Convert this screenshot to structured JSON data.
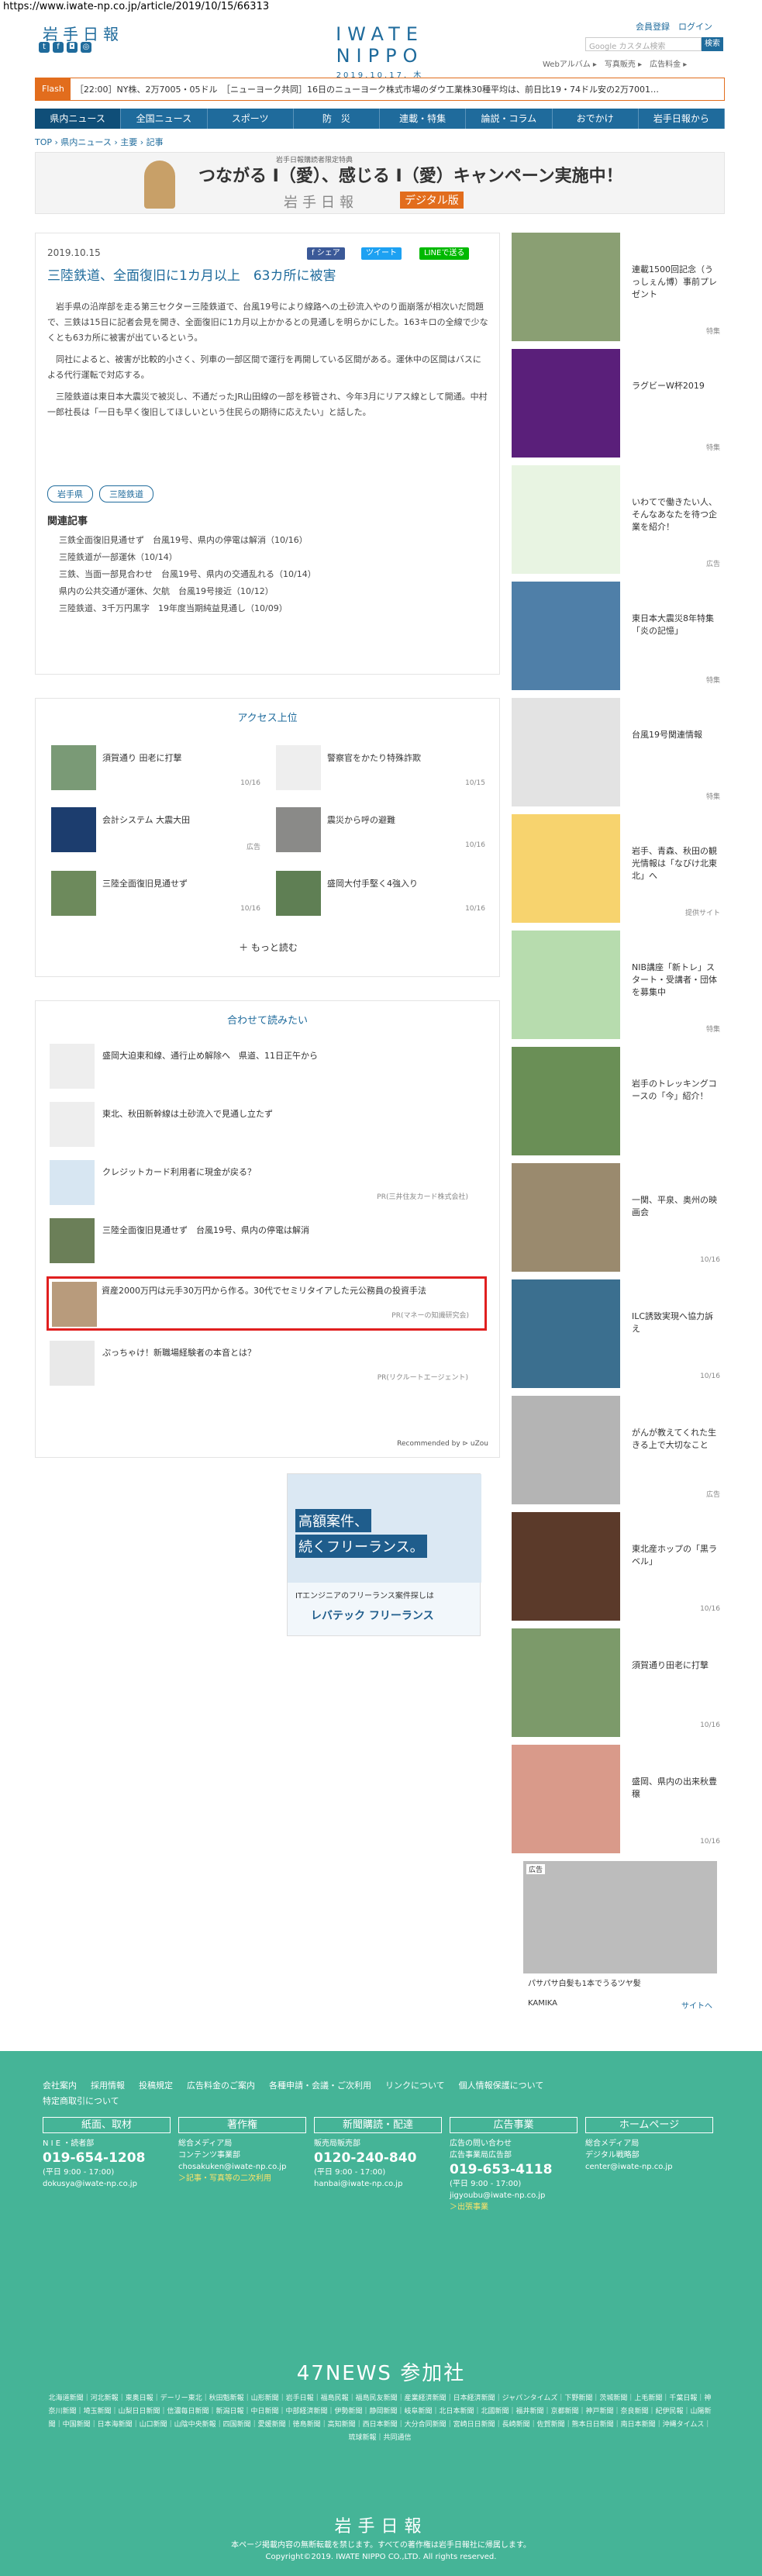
{
  "url": "https://www.iwate-np.co.jp/article/2019/10/15/66313",
  "header": {
    "logo_left": "岩手日報",
    "logo_center": "IWATE NIPPO",
    "date": "2019.10.17. 木",
    "member": "会員登録　ログイン",
    "search_placeholder": "Google カスタム検索",
    "search_btn": "検索",
    "sublinks": "Webアルバム ▸　写真販売 ▸　広告料金 ▸",
    "social": [
      "t",
      "f",
      "◘",
      "◎"
    ]
  },
  "ticker": {
    "label": "Flash",
    "text": "［22:00］NY株、2万7005・05ドル　［ニューヨーク共同］16日のニューヨーク株式市場のダウ工業株30種平均は、前日比19・74ドル安の2万7001…"
  },
  "nav": [
    "県内ニュース",
    "全国ニュース",
    "スポーツ",
    "防　災",
    "連載・特集",
    "論説・コラム",
    "おでかけ",
    "岩手日報から"
  ],
  "breadcrumb": "TOP › 県内ニュース › 主要 › 記事",
  "banner": {
    "title": "つながる I（愛）、感じる I（愛）キャンペーン実施中！",
    "sub": "岩手日報",
    "digital": "デジタル版",
    "top": "岩手日報購読者限定特典"
  },
  "article": {
    "date": "2019.10.15",
    "share": [
      "f シェア",
      "ツイート",
      "LINEで送る"
    ],
    "title": "三陸鉄道、全面復旧に1カ月以上　63カ所に被害",
    "paragraphs": [
      "岩手県の沿岸部を走る第三セクター三陸鉄道で、台風19号により線路への土砂流入やのり面崩落が相次いだ問題で、三鉄は15日に記者会見を開き、全面復旧に1カ月以上かかるとの見通しを明らかにした。163キロの全線で少なくとも63カ所に被害が出ているという。",
      "同社によると、被害が比較的小さく、列車の一部区間で運行を再開している区間がある。運休中の区間はバスによる代行運転で対応する。",
      "三陸鉄道は東日本大震災で被災し、不通だったJR山田線の一部を移管され、今年3月にリアス線として開通。中村一郎社長は「一日も早く復旧してほしいという住民らの期待に応えたい」と話した。"
    ],
    "tags": [
      "岩手県",
      "三陸鉄道"
    ],
    "related_heading": "関連記事",
    "related": [
      "三鉄全面復旧見通せず　台風19号、県内の停電は解消（10/16）",
      "三陸鉄道が一部運休（10/14）",
      "三鉄、当面一部見合わせ　台風19号、県内の交通乱れる（10/14）",
      "県内の公共交通が運休、欠航　台風19号接近（10/12）",
      "三陸鉄道、3千万円黒字　19年度当期純益見通し（10/09）"
    ]
  },
  "access": {
    "heading": "アクセス上位",
    "items": [
      {
        "title": "須賀通り 田老に打撃",
        "date": "10/16"
      },
      {
        "title": "警察官をかたり特殊詐欺",
        "date": "10/15"
      },
      {
        "title": "会計システム 大震大田",
        "date": "広告"
      },
      {
        "title": "震災から呼の避難",
        "date": "10/16"
      },
      {
        "title": "三陸全面復旧見通せず",
        "date": "10/16"
      },
      {
        "title": "盛岡大付手堅く4強入り",
        "date": "10/16"
      }
    ],
    "more": "＋ もっと読む"
  },
  "reads": {
    "heading": "合わせて読みたい",
    "items": [
      {
        "title": "盛岡大迫東和線、通行止め解除へ　県道、11日正午から",
        "pr": ""
      },
      {
        "title": "東北、秋田新幹線は土砂流入で見通し立たず",
        "pr": ""
      },
      {
        "title": "クレジットカード利用者に現金が戻る？",
        "pr": "PR(三井住友カード株式会社)"
      },
      {
        "title": "三陸全面復旧見通せず　台風19号、県内の停電は解消",
        "pr": ""
      },
      {
        "title": "資産2000万円は元手30万円から作る。30代でセミリタイアした元公務員の投資手法",
        "pr": "PR(マネーの知識研究会)"
      },
      {
        "title": "ぷっちゃけ！新職場経験者の本音とは？",
        "pr": "PR(リクルートエージェント)"
      }
    ],
    "recommended": "Recommended by ⊳ uZou"
  },
  "ad2": {
    "line1": "高額案件、",
    "line2": "続くフリーランス。",
    "line3": "ITエンジニアのフリーランス案件探しは",
    "brand": "レバテック フリーランス"
  },
  "sidebar": [
    {
      "title": "連載1500回記念（うっしぇん博）事前プレゼント",
      "tag": "特集"
    },
    {
      "title": "ラグビーW杯2019",
      "tag": "特集"
    },
    {
      "title": "いわてで働きたい人、そんなあなたを待つ企業を紹介！",
      "tag": "広告"
    },
    {
      "title": "東日本大震災8年特集「炎の記憶」",
      "tag": "特集"
    },
    {
      "title": "台風19号関連情報",
      "tag": "特集"
    },
    {
      "title": "岩手、青森、秋田の観光情報は「なびけ北東北」へ",
      "tag": "提供サイト"
    },
    {
      "title": "NIB講座「新トレ」スタート・受講者・団体を募集中",
      "tag": "特集"
    },
    {
      "title": "岩手のトレッキングコースの「今」紹介！",
      "tag": ""
    },
    {
      "title": "一関、平泉、奥州の映画会",
      "tag": "10/16"
    },
    {
      "title": "ILC誘致実現へ協力訴え",
      "tag": "10/16"
    },
    {
      "title": "がんが教えてくれた生きる上で大切なこと",
      "tag": "広告"
    },
    {
      "title": "東北産ホップの「黒ラベル」",
      "tag": "10/16"
    },
    {
      "title": "須賀通り田老に打撃",
      "tag": "10/16"
    },
    {
      "title": "盛岡、県内の出来秋豊穣",
      "tag": "10/16"
    }
  ],
  "sidead": {
    "label": "広告",
    "caption": "パサパサ白髪も1本でうるツヤ髪",
    "brand": "KAMIKA",
    "site": "サイトへ"
  },
  "footer": {
    "links": [
      "会社案内",
      "採用情報",
      "投稿規定",
      "広告料金のご案内",
      "各種申請・会議・ご次利用",
      "リンクについて",
      "個人情報保護について",
      "特定商取引について"
    ],
    "cols": [
      {
        "h": "紙面、取材",
        "l1": "N I E ・読者部",
        "tel": "019-654-1208",
        "hours": "(平日 9:00 - 17:00)",
        "mail": "dokusya@iwate-np.co.jp"
      },
      {
        "h": "著作権",
        "l1": "総合メディア局",
        "l2": "コンテンツ事業部",
        "mail": "chosakuken@iwate-np.co.jp",
        "note": "＞記事・写真等の二次利用"
      },
      {
        "h": "新聞購読・配達",
        "l1": "販売局販売部",
        "tel": "0120-240-840",
        "hours": "(平日 9:00 - 17:00)",
        "mail": "hanbai@iwate-np.co.jp"
      },
      {
        "h": "広告事業",
        "l1": "広告の問い合わせ",
        "l2": "広告事業局広告部",
        "tel": "019-653-4118",
        "hours": "(平日 9:00 - 17:00)",
        "mail": "jigyoubu@iwate-np.co.jp",
        "note": "＞出張事業"
      },
      {
        "h": "ホームページ",
        "l1": "総合メディア局",
        "l2": "デジタル戦略部",
        "mail": "center@iwate-np.co.jp"
      }
    ],
    "news47": "47NEWS 参加社",
    "papers": "北海道新聞｜河北新報｜東奥日報｜デーリー東北｜秋田魁新報｜山形新聞｜岩手日報｜福島民報｜福島民友新聞｜産業経済新聞｜日本経済新聞｜ジャパンタイムズ｜下野新聞｜茨城新聞｜上毛新聞｜千葉日報｜神奈川新聞｜埼玉新聞｜山梨日日新聞｜信濃毎日新聞｜新潟日報｜中日新聞｜中部経済新聞｜伊勢新聞｜静岡新聞｜岐阜新聞｜北日本新聞｜北國新聞｜福井新聞｜京都新聞｜神戸新聞｜奈良新聞｜紀伊民報｜山陽新聞｜中国新聞｜日本海新聞｜山口新聞｜山陰中央新報｜四国新聞｜愛媛新聞｜徳島新聞｜高知新聞｜西日本新聞｜大分合同新聞｜宮崎日日新聞｜長崎新聞｜佐賀新聞｜熊本日日新聞｜南日本新聞｜沖縄タイムス｜琉球新報｜共同通信",
    "logo": "岩手日報",
    "copy1": "本ページ掲載内容の無断転載を禁じます。すべての著作権は岩手日報社に帰属します。",
    "copy2": "Copyright©2019. IWATE NIPPO CO.,LTD. All rights reserved."
  }
}
